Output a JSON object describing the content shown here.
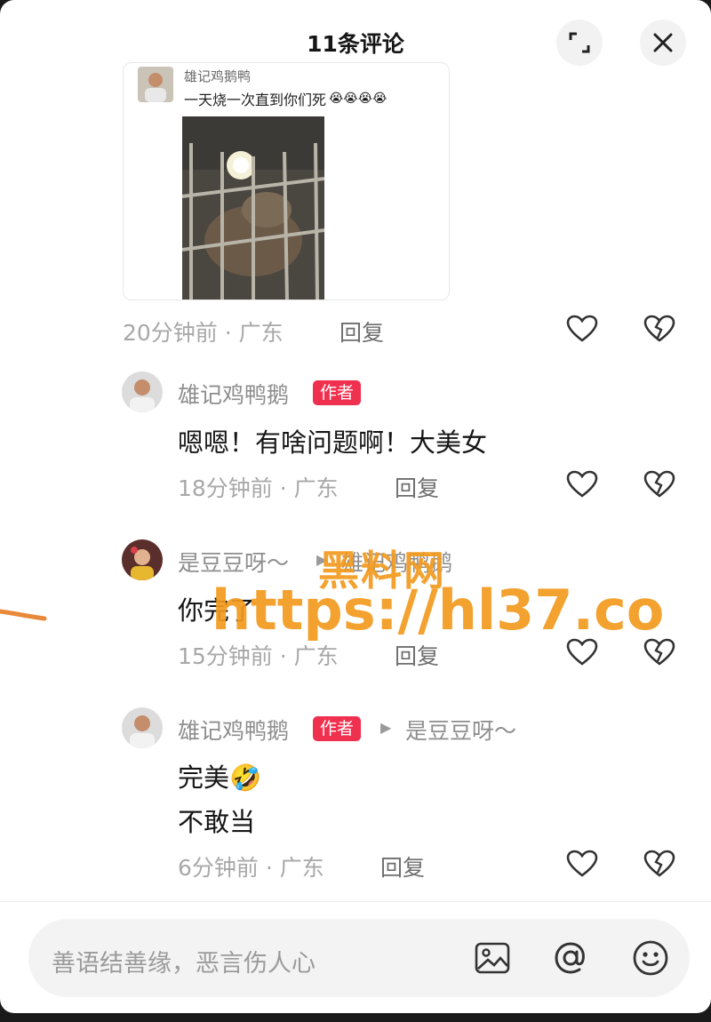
{
  "header": {
    "title": "11条评论"
  },
  "quoted_card": {
    "name": "雄记鸡鹅鸭",
    "text": "一天烧一次直到你们死",
    "emoji": "😭😭😭😭"
  },
  "first_meta": {
    "time": "20分钟前",
    "location": "广东",
    "reply": "回复"
  },
  "comments": [
    {
      "user": "雄记鸡鸭鹅",
      "badge": "作者",
      "target": "",
      "lines": [
        "嗯嗯！有啥问题啊！大美女"
      ],
      "time": "18分钟前",
      "location": "广东",
      "reply": "回复"
    },
    {
      "user": "是豆豆呀～",
      "badge": "",
      "target": "雄记鸡鸭鹅",
      "lines": [
        "你完了"
      ],
      "time": "15分钟前",
      "location": "广东",
      "reply": "回复"
    },
    {
      "user": "雄记鸡鸭鹅",
      "badge": "作者",
      "target": "是豆豆呀～",
      "lines": [
        "完美🤣",
        "不敢当"
      ],
      "time": "6分钟前",
      "location": "广东",
      "reply": "回复"
    }
  ],
  "watermark": {
    "line1": "黑料网",
    "line2": "https://hl37.co"
  },
  "input": {
    "placeholder": "善语结善缘，恶言伤人心"
  },
  "icons": [
    "expand-icon",
    "close-icon",
    "heart-icon",
    "broken-heart-icon",
    "image-icon",
    "at-icon",
    "emoji-icon"
  ],
  "colors": {
    "badge": "#f0304f",
    "watermark": "#f39a1e",
    "stroke": "#e8893a"
  }
}
